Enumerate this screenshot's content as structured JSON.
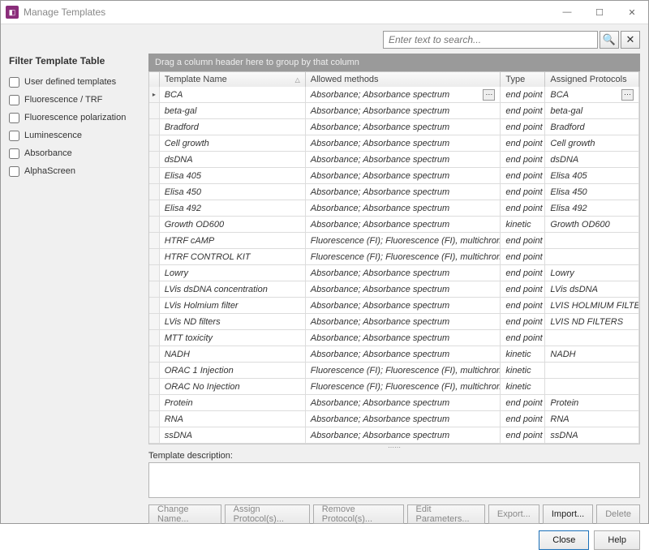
{
  "window": {
    "title": "Manage Templates"
  },
  "search": {
    "placeholder": "Enter text to search..."
  },
  "sidebar": {
    "title": "Filter Template Table",
    "filters": [
      {
        "label": "User defined templates"
      },
      {
        "label": "Fluorescence / TRF"
      },
      {
        "label": "Fluorescence polarization"
      },
      {
        "label": "Luminescence"
      },
      {
        "label": "Absorbance"
      },
      {
        "label": "AlphaScreen"
      }
    ]
  },
  "grid": {
    "group_hint": "Drag a column header here to group by that column",
    "columns": [
      {
        "label": "Template Name"
      },
      {
        "label": "Allowed methods"
      },
      {
        "label": "Type"
      },
      {
        "label": "Assigned Protocols"
      }
    ],
    "rows": [
      {
        "name": "BCA",
        "methods": "Absorbance; Absorbance spectrum",
        "type": "end point",
        "protocols": "BCA",
        "selected": true
      },
      {
        "name": "beta-gal",
        "methods": "Absorbance; Absorbance spectrum",
        "type": "end point",
        "protocols": "beta-gal"
      },
      {
        "name": "Bradford",
        "methods": "Absorbance; Absorbance spectrum",
        "type": "end point",
        "protocols": "Bradford"
      },
      {
        "name": "Cell growth",
        "methods": "Absorbance; Absorbance spectrum",
        "type": "end point",
        "protocols": "Cell growth"
      },
      {
        "name": "dsDNA",
        "methods": "Absorbance; Absorbance spectrum",
        "type": "end point",
        "protocols": "dsDNA"
      },
      {
        "name": "Elisa 405",
        "methods": "Absorbance; Absorbance spectrum",
        "type": "end point",
        "protocols": "Elisa 405"
      },
      {
        "name": "Elisa 450",
        "methods": "Absorbance; Absorbance spectrum",
        "type": "end point",
        "protocols": "Elisa 450"
      },
      {
        "name": "Elisa 492",
        "methods": "Absorbance; Absorbance spectrum",
        "type": "end point",
        "protocols": "Elisa 492"
      },
      {
        "name": "Growth OD600",
        "methods": "Absorbance; Absorbance spectrum",
        "type": "kinetic",
        "protocols": "Growth OD600"
      },
      {
        "name": "HTRF cAMP",
        "methods": "Fluorescence (FI); Fluorescence (FI), multichromat",
        "type": "end point",
        "protocols": ""
      },
      {
        "name": "HTRF CONTROL KIT",
        "methods": "Fluorescence (FI); Fluorescence (FI), multichromat",
        "type": "end point",
        "protocols": ""
      },
      {
        "name": "Lowry",
        "methods": "Absorbance; Absorbance spectrum",
        "type": "end point",
        "protocols": "Lowry"
      },
      {
        "name": "LVis dsDNA concentration",
        "methods": "Absorbance; Absorbance spectrum",
        "type": "end point",
        "protocols": "LVis dsDNA"
      },
      {
        "name": "LVis Holmium filter",
        "methods": "Absorbance; Absorbance spectrum",
        "type": "end point",
        "protocols": "LVIS HOLMIUM FILTER"
      },
      {
        "name": "LVis ND filters",
        "methods": "Absorbance; Absorbance spectrum",
        "type": "end point",
        "protocols": "LVIS ND FILTERS"
      },
      {
        "name": "MTT toxicity",
        "methods": "Absorbance; Absorbance spectrum",
        "type": "end point",
        "protocols": ""
      },
      {
        "name": "NADH",
        "methods": "Absorbance; Absorbance spectrum",
        "type": "kinetic",
        "protocols": "NADH"
      },
      {
        "name": "ORAC 1 Injection",
        "methods": "Fluorescence (FI); Fluorescence (FI), multichromat",
        "type": "kinetic",
        "protocols": ""
      },
      {
        "name": "ORAC No Injection",
        "methods": "Fluorescence (FI); Fluorescence (FI), multichromat",
        "type": "kinetic",
        "protocols": ""
      },
      {
        "name": "Protein",
        "methods": "Absorbance; Absorbance spectrum",
        "type": "end point",
        "protocols": "Protein"
      },
      {
        "name": "RNA",
        "methods": "Absorbance; Absorbance spectrum",
        "type": "end point",
        "protocols": "RNA"
      },
      {
        "name": "ssDNA",
        "methods": "Absorbance; Absorbance spectrum",
        "type": "end point",
        "protocols": "ssDNA"
      }
    ]
  },
  "description": {
    "label": "Template description:"
  },
  "actions": {
    "change_name": "Change Name...",
    "assign": "Assign Protocol(s)...",
    "remove": "Remove Protocol(s)...",
    "edit": "Edit Parameters...",
    "export": "Export...",
    "import": "Import...",
    "delete": "Delete"
  },
  "footer": {
    "close": "Close",
    "help": "Help"
  }
}
